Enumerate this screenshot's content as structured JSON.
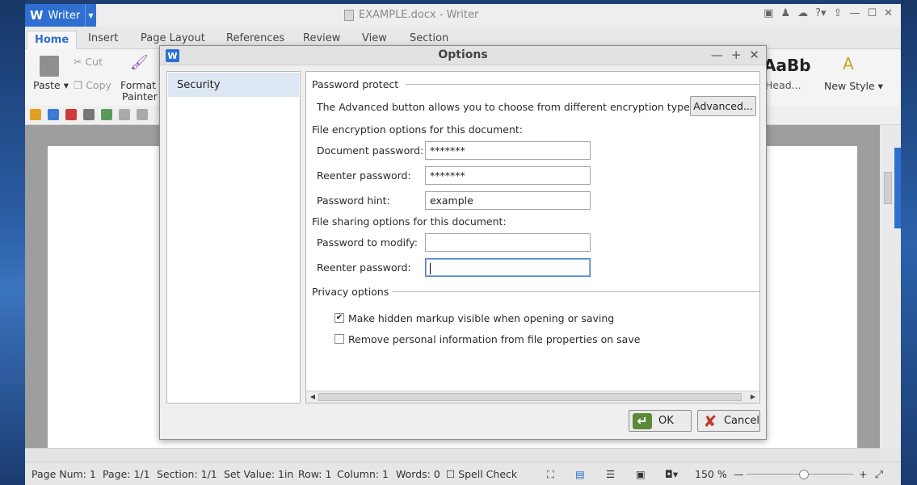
{
  "app": {
    "badge": "Writer",
    "logo": "W",
    "window_title": "EXAMPLE.docx - Writer"
  },
  "tabs": [
    "Home",
    "Insert",
    "Page Layout",
    "References",
    "Review",
    "View",
    "Section"
  ],
  "ribbon": {
    "paste": "Paste",
    "cut": "Cut",
    "copy": "Copy",
    "format_painter_line1": "Format",
    "format_painter_line2": "Painter",
    "style_preview": "AaBb",
    "style_name": "Head...",
    "new_style": "New Style"
  },
  "dialog": {
    "title": "Options",
    "logo": "W",
    "nav_items": [
      "Security"
    ],
    "password_protect": {
      "heading": "Password protect",
      "advanced_text": "The Advanced button allows you to choose from different encryption types.",
      "advanced_button": "Advanced..."
    },
    "encryption": {
      "heading": "File encryption options for this document:",
      "document_password_label": "Document password:",
      "document_password_value": "*******",
      "reenter_password_label": "Reenter password:",
      "reenter_password_value": "*******",
      "hint_label": "Password hint:",
      "hint_value": "example"
    },
    "sharing": {
      "heading": "File sharing options for this document:",
      "modify_label": "Password to modify:",
      "modify_value": "",
      "reenter_label": "Reenter password:",
      "reenter_value": ""
    },
    "privacy": {
      "heading": "Privacy options",
      "markup_label": "Make hidden markup visible when opening or saving",
      "markup_checked": true,
      "remove_label": "Remove personal information from file properties on save",
      "remove_checked": false
    },
    "ok_button": "OK",
    "cancel_button": "Cancel"
  },
  "statusbar": {
    "page_num": "Page Num: 1",
    "page": "Page: 1/1",
    "section": "Section: 1/1",
    "set_value": "Set Value: 1in",
    "row": "Row: 1",
    "column": "Column: 1",
    "words": "Words: 0",
    "spell": "Spell Check",
    "zoom": "150 %"
  },
  "colors": {
    "accent": "#2e6fd1",
    "desktop": "#1f3f72",
    "cancel_icon": "#c0392b",
    "ok_icon": "#5b8a3a"
  }
}
